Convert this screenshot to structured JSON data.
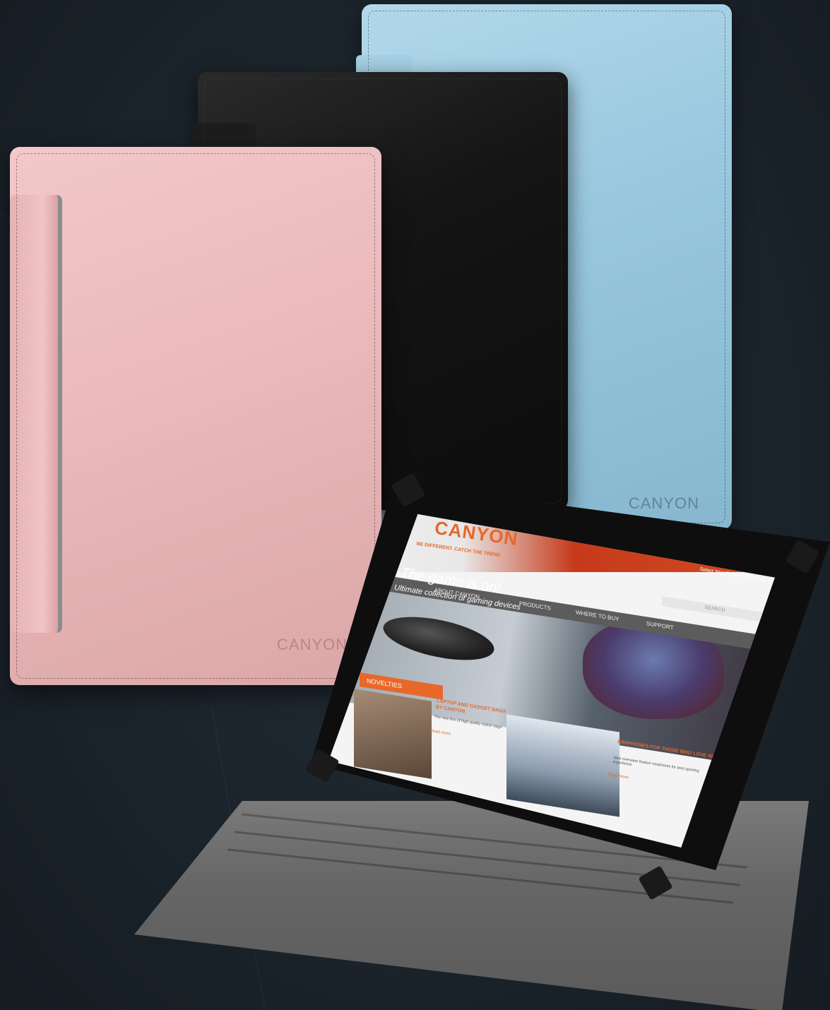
{
  "product": {
    "brand_logo": "CANYON",
    "cases": [
      {
        "name": "blue-case",
        "color": "#9fcde3"
      },
      {
        "name": "black-case",
        "color": "#161616"
      },
      {
        "name": "pink-case",
        "color": "#ecbcbd"
      }
    ]
  },
  "screen": {
    "logo": "CANYON",
    "tagline": "BE DIFFERENT. CATCH THE TREND",
    "region": "Select Your Region | Site Map",
    "nav": [
      "ABOUT CANYON",
      "PRODUCTS",
      "WHERE TO BUY",
      "SUPPORT"
    ],
    "search_placeholder": "SEARCH",
    "banner_title": "The game is on!",
    "banner_subtitle": "Ultimate collection of gaming devices",
    "section_label": "NOVELTIES",
    "cards": [
      {
        "title": "LAPTOP AND GADGET BAGS BY CANYON",
        "desc": "The new line of high quality stylish bags",
        "link": "Read more"
      },
      {
        "title": "EARPHONES FOR THOSE WHO LOVE SPORTS",
        "desc": "New overwear fixation earphones for best sporting experience",
        "link": "Read more"
      }
    ],
    "accent_color": "#e8682a"
  }
}
